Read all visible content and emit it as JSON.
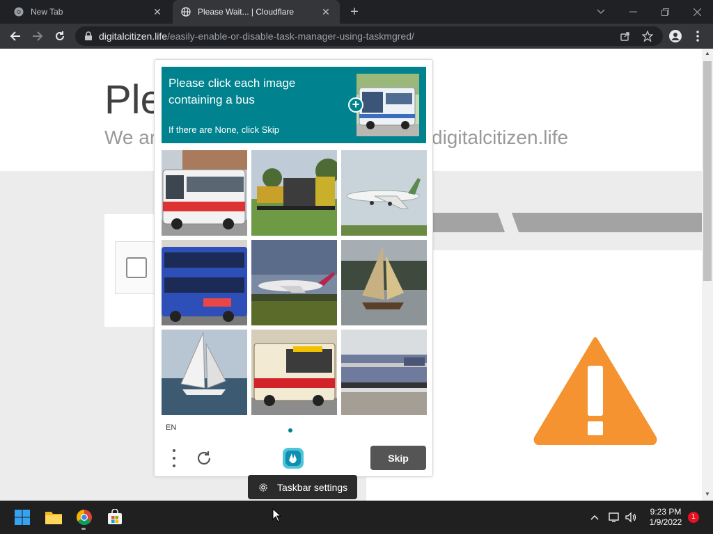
{
  "browser": {
    "tabs": [
      {
        "title": "New Tab",
        "active": false,
        "icon": "chrome-icon"
      },
      {
        "title": "Please Wait... | Cloudflare",
        "active": true,
        "icon": "globe-icon"
      }
    ],
    "url_domain": "digitalcitizen.life",
    "url_path": "/easily-enable-or-disable-task-manager-using-taskmgred/"
  },
  "page": {
    "heading_fragment": "Ple",
    "subtitle_left_fragment": "We ar",
    "subtitle_right_fragment": "digitalcitizen.life"
  },
  "captcha": {
    "prompt": "Please click each image containing a bus",
    "hint": "If there are None, click Skip",
    "example_image": "bus",
    "tiles": [
      {
        "subject": "bus"
      },
      {
        "subject": "train"
      },
      {
        "subject": "airplane"
      },
      {
        "subject": "bus"
      },
      {
        "subject": "airplane"
      },
      {
        "subject": "sailboat"
      },
      {
        "subject": "sailboat"
      },
      {
        "subject": "bus"
      },
      {
        "subject": "train"
      }
    ],
    "language": "EN",
    "skip_label": "Skip",
    "accent_color": "#00838f"
  },
  "tooltip": {
    "label": "Taskbar settings"
  },
  "taskbar": {
    "time": "9:23 PM",
    "date": "1/9/2022",
    "notification_count": "1",
    "apps": [
      "start-icon",
      "file-explorer-icon",
      "chrome-icon",
      "store-icon"
    ]
  },
  "colors": {
    "warning": "#f4932f",
    "chrome_dark": "#202124",
    "chrome_mid": "#35363a"
  }
}
